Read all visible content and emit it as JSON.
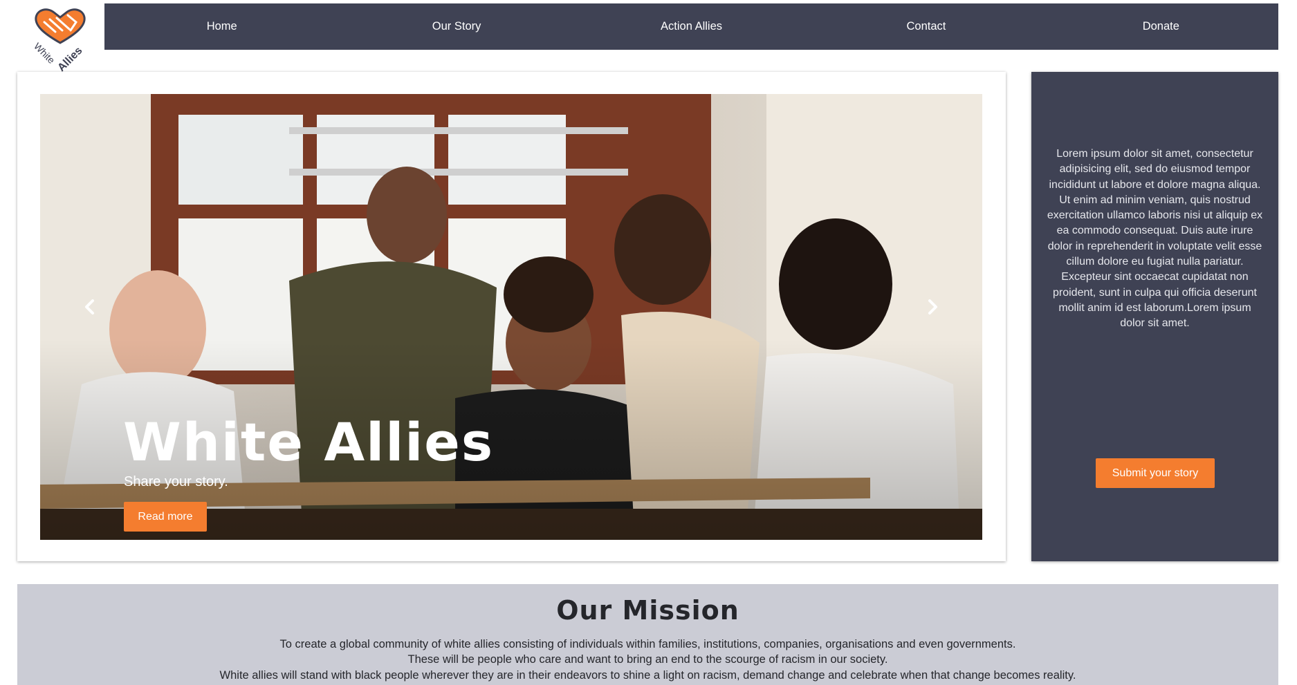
{
  "brand": {
    "logo_line1": "White",
    "logo_line2": "Allies",
    "icon": "heart-handshake-icon",
    "accent_color": "#f47d2f",
    "navy_color": "#3f4254"
  },
  "nav": {
    "items": [
      {
        "label": "Home"
      },
      {
        "label": "Our Story"
      },
      {
        "label": "Action Allies"
      },
      {
        "label": "Contact"
      },
      {
        "label": "Donate"
      }
    ]
  },
  "hero": {
    "title": "White Allies",
    "subtitle": "Share your story.",
    "button": "Read more",
    "prev_icon": "chevron-left-icon",
    "next_icon": "chevron-right-icon"
  },
  "side": {
    "text": "Lorem ipsum dolor sit amet, consectetur adipisicing elit, sed do eiusmod tempor incididunt ut labore et dolore magna aliqua. Ut enim ad minim veniam, quis nostrud exercitation ullamco laboris nisi ut aliquip ex ea commodo consequat. Duis aute irure dolor in reprehenderit in voluptate velit esse cillum dolore eu fugiat nulla pariatur. Excepteur sint occaecat cupidatat non proident, sunt in culpa qui officia deserunt mollit anim id est laborum.Lorem ipsum dolor sit amet.",
    "button": "Submit your story"
  },
  "mission": {
    "title": "Our Mission",
    "lines": [
      "To create a global community of white allies consisting of individuals within families, institutions, companies, organisations and even governments.",
      "These will be people who care and want to bring an end to the scourge of racism in our society.",
      "White allies will stand with black people wherever they are in their endeavors to shine a light on racism, demand change and celebrate when that change becomes reality."
    ]
  }
}
